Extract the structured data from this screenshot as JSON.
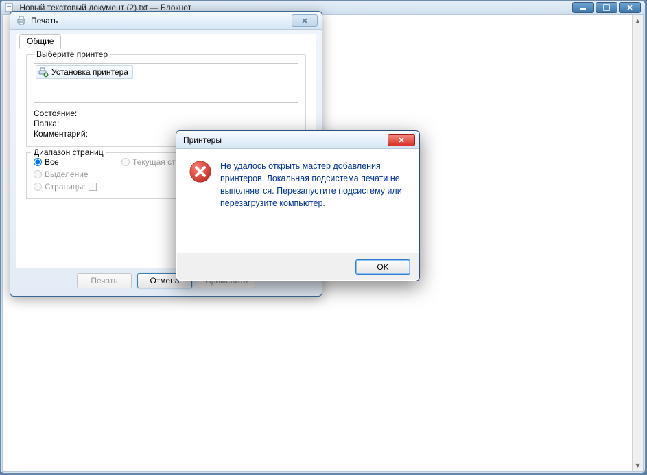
{
  "notepad": {
    "title": "Новый текстовый документ (2).txt — Блокнот"
  },
  "window_controls": {
    "minimize": "–",
    "maximize": "□",
    "close": "×"
  },
  "print_dialog": {
    "title": "Печать",
    "tab_general": "Общие",
    "select_printer_legend": "Выберите принтер",
    "add_printer_item": "Установка принтера",
    "status_label": "Состояние:",
    "folder_label": "Папка:",
    "comment_label": "Комментарий:",
    "range_legend": "Диапазон страниц",
    "range_all": "Все",
    "range_selection": "Выделение",
    "range_pages": "Страницы:",
    "range_current": "Текущая страница",
    "pages_value": "",
    "btn_print": "Печать",
    "btn_cancel": "Отмена",
    "btn_apply": "Применить"
  },
  "error_dialog": {
    "title": "Принтеры",
    "message": "Не удалось открыть мастер добавления принтеров. Локальная подсистема печати не выполняется. Перезапустите подсистему или перезагрузите компьютер.",
    "btn_ok": "OK"
  }
}
